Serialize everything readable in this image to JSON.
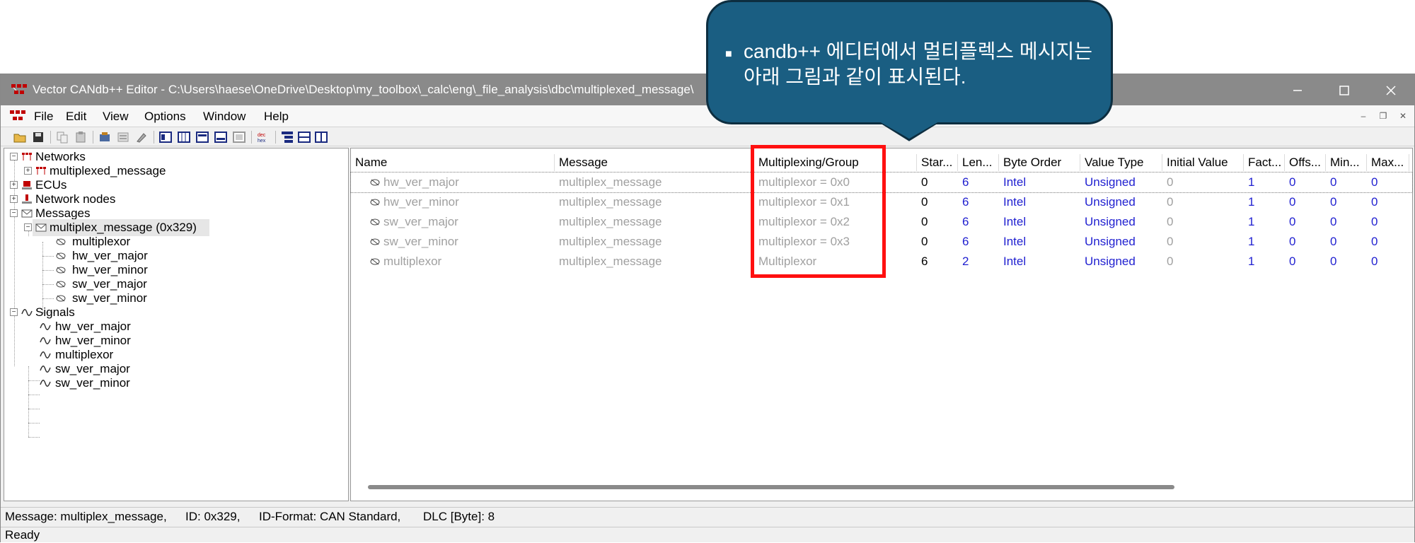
{
  "window": {
    "title": "Vector CANdb++ Editor - C:\\Users\\haese\\OneDrive\\Desktop\\my_toolbox\\_calc\\eng\\_file_analysis\\dbc\\multiplexed_message\\",
    "controls": {
      "minimize": "minimize-icon",
      "maximize": "maximize-icon",
      "close": "close-icon"
    }
  },
  "menubar": {
    "items": [
      "File",
      "Edit",
      "View",
      "Options",
      "Window",
      "Help"
    ]
  },
  "toolbar": {
    "icons": [
      "open-icon",
      "save-icon",
      "copy-icon",
      "paste-icon",
      "database-icon",
      "list-icon",
      "wizard-icon",
      "view1-icon",
      "view2-icon",
      "view3-icon",
      "view4-icon",
      "view5-icon",
      "dec-hex-icon",
      "tree-view-icon",
      "split-horizontal-icon",
      "split-vertical-icon"
    ],
    "dec_hex_label": "dec hex"
  },
  "tree": {
    "networks": "Networks",
    "network_child": "multiplexed_message",
    "ecus": "ECUs",
    "network_nodes": "Network nodes",
    "messages": "Messages",
    "message_child": "multiplex_message (0x329)",
    "message_signals": [
      "multiplexor",
      "hw_ver_major",
      "hw_ver_minor",
      "sw_ver_major",
      "sw_ver_minor"
    ],
    "signals": "Signals",
    "signal_items": [
      "hw_ver_major",
      "hw_ver_minor",
      "multiplexor",
      "sw_ver_major",
      "sw_ver_minor"
    ]
  },
  "grid": {
    "columns": [
      "Name",
      "Message",
      "Multiplexing/Group",
      "Star...",
      "Len...",
      "Byte Order",
      "Value Type",
      "Initial Value",
      "Fact...",
      "Offs...",
      "Min...",
      "Max..."
    ],
    "rows": [
      {
        "name": "hw_ver_major",
        "message": "multiplex_message",
        "mux": "multiplexor = 0x0",
        "start": "0",
        "len": "6",
        "order": "Intel",
        "vtype": "Unsigned",
        "init": "0",
        "factor": "1",
        "offset": "0",
        "min": "0",
        "max": "0"
      },
      {
        "name": "hw_ver_minor",
        "message": "multiplex_message",
        "mux": "multiplexor = 0x1",
        "start": "0",
        "len": "6",
        "order": "Intel",
        "vtype": "Unsigned",
        "init": "0",
        "factor": "1",
        "offset": "0",
        "min": "0",
        "max": "0"
      },
      {
        "name": "sw_ver_major",
        "message": "multiplex_message",
        "mux": "multiplexor = 0x2",
        "start": "0",
        "len": "6",
        "order": "Intel",
        "vtype": "Unsigned",
        "init": "0",
        "factor": "1",
        "offset": "0",
        "min": "0",
        "max": "0"
      },
      {
        "name": "sw_ver_minor",
        "message": "multiplex_message",
        "mux": "multiplexor = 0x3",
        "start": "0",
        "len": "6",
        "order": "Intel",
        "vtype": "Unsigned",
        "init": "0",
        "factor": "1",
        "offset": "0",
        "min": "0",
        "max": "0"
      },
      {
        "name": "multiplexor",
        "message": "multiplex_message",
        "mux": "Multiplexor",
        "start": "6",
        "len": "2",
        "order": "Intel",
        "vtype": "Unsigned",
        "init": "0",
        "factor": "1",
        "offset": "0",
        "min": "0",
        "max": "0"
      }
    ]
  },
  "status": {
    "message": "Message: multiplex_message,",
    "id": "ID: 0x329,",
    "id_format": "ID-Format: CAN Standard,",
    "dlc": "DLC [Byte]: 8",
    "ready": "Ready"
  },
  "callout": {
    "text": "candb++ 에디터에서 멀티플렉스 메시지는 아래 그림과 같이 표시된다."
  },
  "colors": {
    "callout_fill": "#1a5e82",
    "highlight": "#ff1010",
    "value_blue": "#1f1fd0",
    "titlebar": "#8a8a8a"
  }
}
